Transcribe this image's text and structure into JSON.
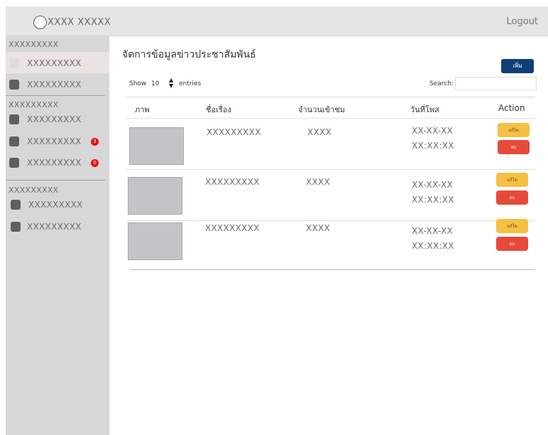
{
  "header": {
    "brand": "XXXX XXXXX",
    "logout_label": "Logout"
  },
  "sidebar": {
    "section1_title": "XXXXXXXXX",
    "section1_items": [
      {
        "label": "XXXXXXXXX"
      },
      {
        "label": "XXXXXXXXX"
      }
    ],
    "section2_title": "XXXXXXXXX",
    "section2_items": [
      {
        "label": "XXXXXXXXX",
        "badge": ""
      },
      {
        "label": "XXXXXXXXX",
        "badge": "3"
      },
      {
        "label": "XXXXXXXXX",
        "badge": "0"
      }
    ],
    "section3_title": "XXXXXXXXX",
    "section3_items": [
      {
        "label": "XXXXXXXXX"
      },
      {
        "label": "XXXXXXXXX"
      }
    ]
  },
  "main": {
    "page_title": "จัดการข้อมูลข่าวประชาสัมพันธ์",
    "add_label": "เพิ่ม",
    "show_label": "Show",
    "entries_value": "10",
    "entries_label": "entries",
    "search_label": "Search:",
    "search_value": "",
    "columns": [
      "ภาพ",
      "ชื่อเรื่อง",
      "จำนวนเข้าชม",
      "วันที่โพส",
      "Action"
    ],
    "rows": [
      {
        "title": "XXXXXXXXX",
        "views": "XXXX",
        "date": "XX-XX-XX",
        "time": "XX:XX:XX",
        "edit_label": "แก้ไข",
        "delete_label": "ลบ"
      },
      {
        "title": "XXXXXXXXX",
        "views": "XXXX",
        "date": "XX-XX-XX",
        "time": "XX:XX:XX",
        "edit_label": "แก้ไข",
        "delete_label": "ลบ"
      },
      {
        "title": "XXXXXXXXX",
        "views": "XXXX",
        "date": "XX-XX-XX",
        "time": "XX:XX:XX",
        "edit_label": "แก้ไข",
        "delete_label": "ลบ"
      }
    ]
  },
  "colors": {
    "primary": "#0f3e79",
    "edit": "#f5c043",
    "delete": "#e74a3b",
    "badge": "#e81010",
    "sidebar_bg": "#d7d7d7",
    "header_bg": "#e5e5e5"
  },
  "icons": [
    "logo-circle-icon",
    "menu-square-icon",
    "sort-arrows-icon"
  ]
}
